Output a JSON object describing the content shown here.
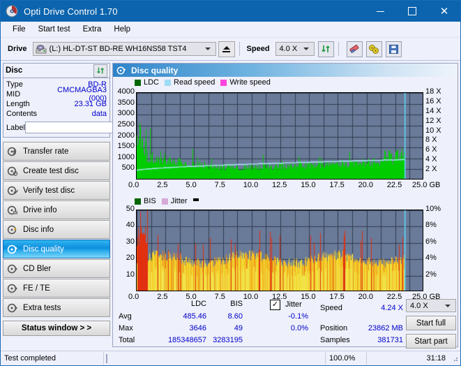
{
  "window": {
    "title": "Opti Drive Control 1.70",
    "icon": "disc-icon",
    "minimize": "–",
    "maximize": "□",
    "close": "✕"
  },
  "menu": {
    "items": [
      "File",
      "Start test",
      "Extra",
      "Help"
    ]
  },
  "toolbar": {
    "drive_label": "Drive",
    "drive_value": "(L:)  HL-DT-ST BD-RE  WH16NS58 TST4",
    "eject": "eject-icon",
    "speed_label": "Speed",
    "speed_value": "4.0 X",
    "refresh_icon": "refresh-icon",
    "erase_icon": "eraser-icon",
    "settings_icon": "gears-icon",
    "save_icon": "save-icon"
  },
  "disc": {
    "title": "Disc",
    "refresh_icon": "refresh-icon",
    "rows": [
      {
        "key": "Type",
        "value": "BD-R"
      },
      {
        "key": "MID",
        "value": "CMCMAGBA3 (000)"
      },
      {
        "key": "Length",
        "value": "23.31 GB"
      },
      {
        "key": "Contents",
        "value": "data"
      }
    ],
    "label_key": "Label",
    "label_value": "",
    "label_placeholder": "",
    "label_btn_icon": "disc-icon"
  },
  "nav": {
    "items": [
      {
        "label": "Transfer rate",
        "icon": "disc-speed-icon",
        "active": false
      },
      {
        "label": "Create test disc",
        "icon": "disc-write-icon",
        "active": false
      },
      {
        "label": "Verify test disc",
        "icon": "disc-verify-icon",
        "active": false
      },
      {
        "label": "Drive info",
        "icon": "drive-info-icon",
        "active": false
      },
      {
        "label": "Disc info",
        "icon": "disc-info-icon",
        "active": false
      },
      {
        "label": "Disc quality",
        "icon": "disc-quality-icon",
        "active": true
      },
      {
        "label": "CD Bler",
        "icon": "disc-bler-icon",
        "active": false
      },
      {
        "label": "FE / TE",
        "icon": "disc-fete-icon",
        "active": false
      },
      {
        "label": "Extra tests",
        "icon": "disc-extra-icon",
        "active": false
      }
    ],
    "status_window": "Status window > >"
  },
  "panel": {
    "title": "Disc quality",
    "icon": "disc-quality-icon"
  },
  "stats": {
    "col_headers": [
      "LDC",
      "BIS"
    ],
    "row_headers": [
      "Avg",
      "Max",
      "Total"
    ],
    "ldc": {
      "avg": "485.46",
      "max": "3646",
      "total": "185348657"
    },
    "bis": {
      "avg": "8.60",
      "max": "49",
      "total": "3283195"
    },
    "jitter": {
      "label": "Jitter",
      "checked": true,
      "checkmark": "✓",
      "avg": "-0.1%",
      "max": "0.0%"
    },
    "speed_label": "Speed",
    "speed_value": "4.24 X",
    "position_label": "Position",
    "position_value": "23862 MB",
    "samples_label": "Samples",
    "samples_value": "381731",
    "speed_select": "4.0 X",
    "start_full": "Start full",
    "start_part": "Start part"
  },
  "statusbar": {
    "message": "Test completed",
    "percent_text": "100.0%",
    "percent_value": 100,
    "elapsed": "31:18"
  },
  "colors": {
    "accent": "#0b64ad",
    "plot_bg": "#6a7a99",
    "ldc_green": "#00cc00",
    "read_speed": "#9fdcf5",
    "write_speed": "#ff44dd",
    "bis_green": "#00a000",
    "jitter_pink": "#d7aad8",
    "value_blue": "#0000cc",
    "progress_green": "#09b509"
  },
  "chart_data": [
    {
      "type": "area",
      "name": "top-chart-ldc",
      "title": "",
      "xlabel": "GB",
      "ylabel": "LDC",
      "legend": [
        {
          "label": "LDC",
          "color": "#006600"
        },
        {
          "label": "Read speed",
          "color": "#9fdcf5"
        },
        {
          "label": "Write speed",
          "color": "#ff44dd"
        }
      ],
      "legend_position": "top-left",
      "grid": true,
      "xlim": [
        0,
        25.0
      ],
      "xticks": [
        "0.0",
        "2.5",
        "5.0",
        "7.5",
        "10.0",
        "12.5",
        "15.0",
        "17.5",
        "20.0",
        "22.5",
        "25.0"
      ],
      "x_unit": "GB",
      "ylim": [
        0,
        4000
      ],
      "yticks": [
        500,
        1000,
        1500,
        2000,
        2500,
        3000,
        3500,
        4000
      ],
      "y2lim": [
        0,
        18
      ],
      "y2ticks": [
        "2 X",
        "4 X",
        "6 X",
        "8 X",
        "10 X",
        "12 X",
        "14 X",
        "16 X",
        "18 X"
      ],
      "series": [
        {
          "name": "LDC",
          "color": "#00cc00",
          "style": "bars",
          "data_summary": {
            "avg": 485.46,
            "max": 3646,
            "total": 185348657,
            "samples": 381731
          }
        },
        {
          "name": "Read speed",
          "color": "#9fdcf5",
          "style": "line",
          "start_x_speed": 2.0,
          "end_x_speed": 4.24
        }
      ],
      "data_end_x": 23.31
    },
    {
      "type": "area",
      "name": "bottom-chart-bis-jitter",
      "title": "",
      "xlabel": "GB",
      "ylabel": "BIS",
      "legend": [
        {
          "label": "BIS",
          "color": "#006600"
        },
        {
          "label": "Jitter",
          "color": "#d7aad8"
        }
      ],
      "legend_position": "top-left",
      "grid": true,
      "xlim": [
        0,
        25.0
      ],
      "xticks": [
        "0.0",
        "2.5",
        "5.0",
        "7.5",
        "10.0",
        "12.5",
        "15.0",
        "17.5",
        "20.0",
        "22.5",
        "25.0"
      ],
      "x_unit": "GB",
      "ylim": [
        0,
        50
      ],
      "yticks": [
        10,
        20,
        30,
        40,
        50
      ],
      "y2lim": [
        0,
        10
      ],
      "y2ticks": [
        "2%",
        "4%",
        "6%",
        "8%",
        "10%"
      ],
      "series": [
        {
          "name": "BIS",
          "color": "#00a000",
          "style": "bars",
          "data_summary": {
            "avg": 8.6,
            "max": 49,
            "total": 3283195
          }
        },
        {
          "name": "Jitter",
          "color": "#d7aad8",
          "style": "bars",
          "data_summary": {
            "avg": "-0.1%",
            "max": "0.0%"
          }
        }
      ],
      "data_end_x": 23.31
    }
  ]
}
